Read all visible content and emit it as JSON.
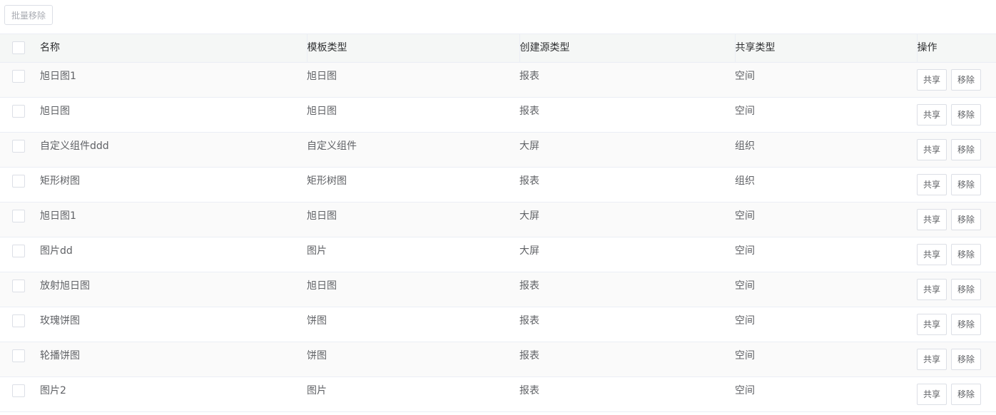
{
  "toolbar": {
    "batch_remove_label": "批量移除"
  },
  "table": {
    "columns": {
      "name": "名称",
      "template_type": "模板类型",
      "source_type": "创建源类型",
      "share_type": "共享类型",
      "actions": "操作"
    },
    "action_labels": {
      "share": "共享",
      "remove": "移除"
    },
    "rows": [
      {
        "name": "旭日图1",
        "template_type": "旭日图",
        "source_type": "报表",
        "share_type": "空间"
      },
      {
        "name": "旭日图",
        "template_type": "旭日图",
        "source_type": "报表",
        "share_type": "空间"
      },
      {
        "name": "自定义组件ddd",
        "template_type": "自定义组件",
        "source_type": "大屏",
        "share_type": "组织"
      },
      {
        "name": "矩形树图",
        "template_type": "矩形树图",
        "source_type": "报表",
        "share_type": "组织"
      },
      {
        "name": "旭日图1",
        "template_type": "旭日图",
        "source_type": "大屏",
        "share_type": "空间"
      },
      {
        "name": "图片dd",
        "template_type": "图片",
        "source_type": "大屏",
        "share_type": "空间"
      },
      {
        "name": "放射旭日图",
        "template_type": "旭日图",
        "source_type": "报表",
        "share_type": "空间"
      },
      {
        "name": "玫瑰饼图",
        "template_type": "饼图",
        "source_type": "报表",
        "share_type": "空间"
      },
      {
        "name": "轮播饼图",
        "template_type": "饼图",
        "source_type": "报表",
        "share_type": "空间"
      },
      {
        "name": "图片2",
        "template_type": "图片",
        "source_type": "报表",
        "share_type": "空间"
      }
    ]
  }
}
